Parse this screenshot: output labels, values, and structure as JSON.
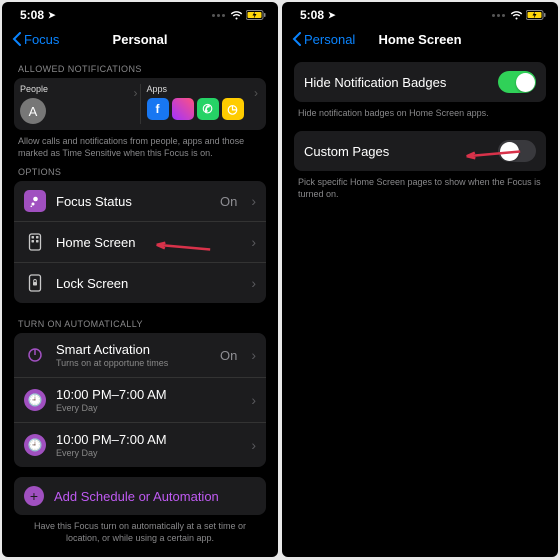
{
  "statusbar": {
    "time": "5:08",
    "loc_glyph": "➤"
  },
  "left": {
    "back": "Focus",
    "title": "Personal",
    "section_allowed": "ALLOWED NOTIFICATIONS",
    "people_label": "People",
    "people_initial": "A",
    "apps_label": "Apps",
    "allowed_footer": "Allow calls and notifications from people, apps and those marked as Time Sensitive when this Focus is on.",
    "section_options": "OPTIONS",
    "options": [
      {
        "label": "Focus Status",
        "value": "On"
      },
      {
        "label": "Home Screen",
        "value": ""
      },
      {
        "label": "Lock Screen",
        "value": ""
      }
    ],
    "section_auto": "TURN ON AUTOMATICALLY",
    "smart": {
      "label": "Smart Activation",
      "sub": "Turns on at opportune times",
      "value": "On"
    },
    "schedule": {
      "label": "10:00 PM–7:00 AM",
      "sub": "Every Day"
    },
    "add_label": "Add Schedule or Automation",
    "auto_footer": "Have this Focus turn on automatically at a set time or location, or while using a certain app."
  },
  "right": {
    "back": "Personal",
    "title": "Home Screen",
    "hide_label": "Hide Notification Badges",
    "hide_footer": "Hide notification badges on Home Screen apps.",
    "custom_label": "Custom Pages",
    "custom_footer": "Pick specific Home Screen pages to show when the Focus is turned on."
  }
}
